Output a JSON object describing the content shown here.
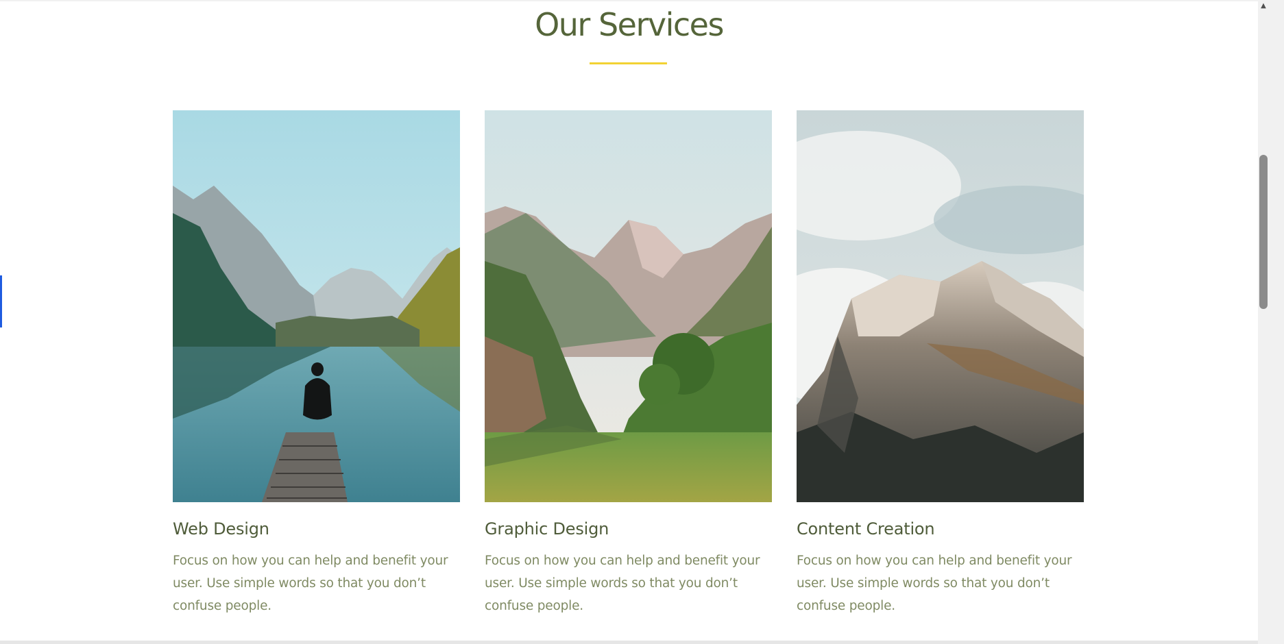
{
  "section": {
    "title": "Our Services",
    "accent_color": "#f2d233",
    "title_color": "#55653a"
  },
  "services": [
    {
      "title": "Web Design",
      "description": "Focus on how you can help and benefit your user. Use simple words so that you don’t confuse people.",
      "image": "photo of a person sitting on a wooden dock at a mountain lake"
    },
    {
      "title": "Graphic Design",
      "description": "Focus on how you can help and benefit your user. Use simple words so that you don’t confuse people.",
      "image": "photo of a green mountain valley with snowy peaks"
    },
    {
      "title": "Content Creation",
      "description": "Focus on how you can help and benefit your user. Use simple words so that you don’t confuse people.",
      "image": "photo of a rocky mountain peak above clouds"
    }
  ],
  "scrollbar": {
    "up_arrow_icon": "chevron-up-icon",
    "position_fraction": 0.33
  }
}
